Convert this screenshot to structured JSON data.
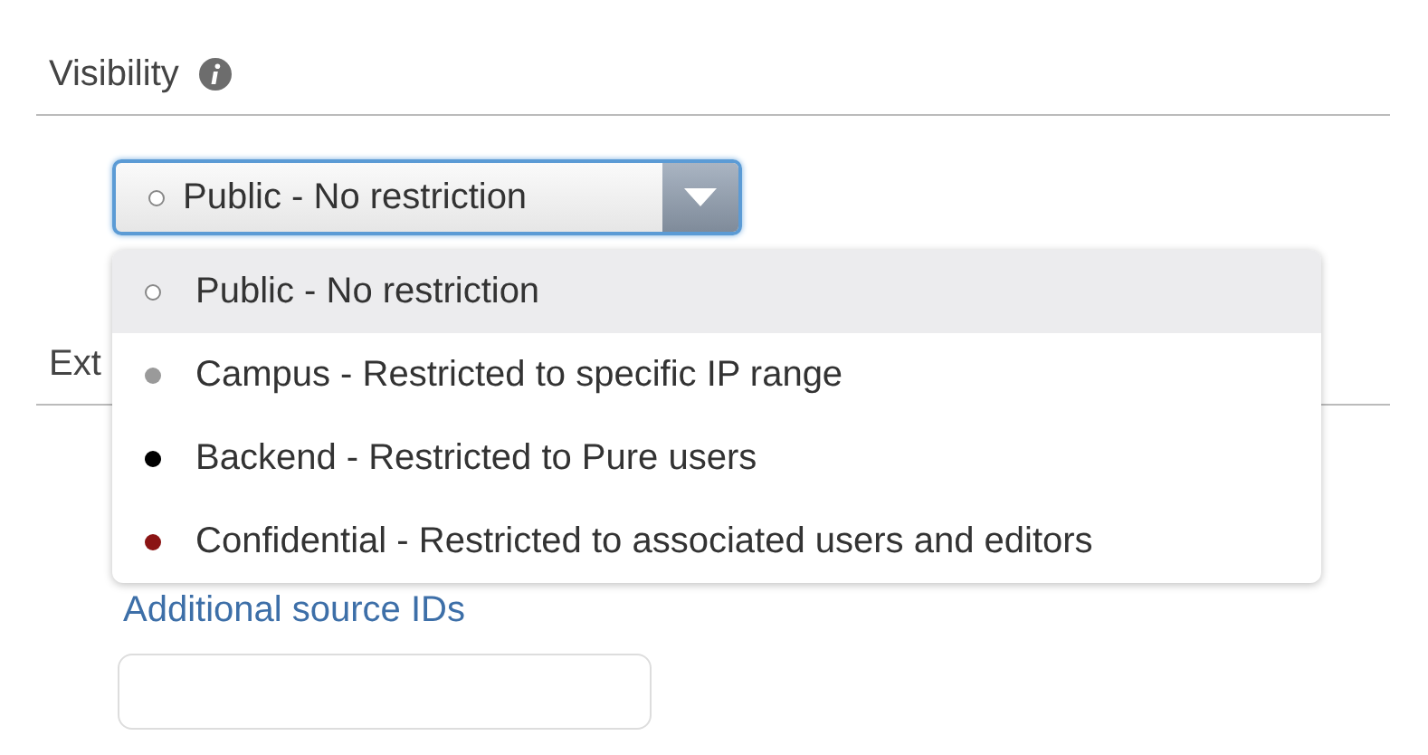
{
  "visibility": {
    "label": "Visibility",
    "select": {
      "value": "Public - No restriction",
      "color": "#ffffff"
    },
    "dropdown": {
      "options": [
        {
          "label": "Public - No restriction",
          "color": "#ffffff",
          "selected": true
        },
        {
          "label": "Campus - Restricted to specific IP range",
          "color": "#9a9a9a",
          "selected": false
        },
        {
          "label": "Backend - Restricted to Pure users",
          "color": "#000000",
          "selected": false
        },
        {
          "label": "Confidential - Restricted to associated users and editors",
          "color": "#8b1414",
          "selected": false
        }
      ]
    }
  },
  "external": {
    "label": "Ext",
    "link": "Additional source IDs"
  }
}
